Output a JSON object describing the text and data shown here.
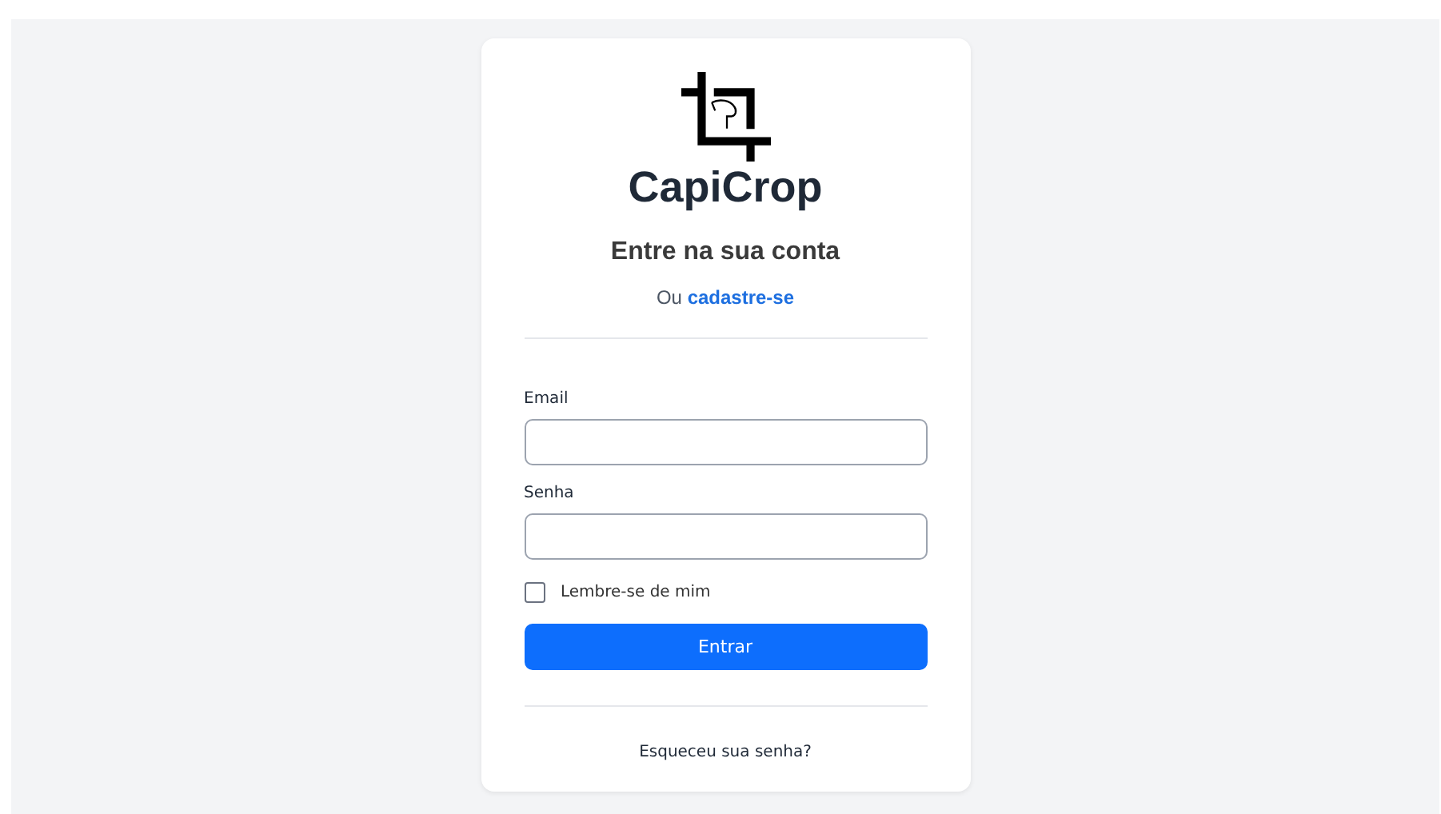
{
  "logo": {
    "name": "CapiCrop"
  },
  "heading": "Entre na sua conta",
  "signup": {
    "prefix": "Ou",
    "link": "cadastre-se"
  },
  "fields": [
    {
      "label": "Email"
    },
    {
      "label": "Senha"
    }
  ],
  "remember": {
    "label": "Lembre-se de mim",
    "checked": false
  },
  "submit": "Entrar",
  "forgot": "Esqueceu sua senha?"
}
